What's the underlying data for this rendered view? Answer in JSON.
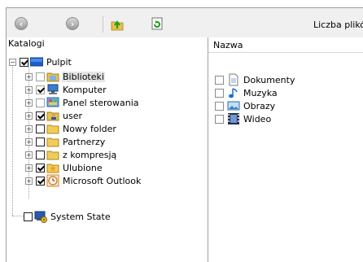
{
  "toolbar": {
    "back_icon": "back-arrow-icon",
    "forward_icon": "forward-arrow-icon",
    "up_icon": "up-folder-icon",
    "refresh_icon": "refresh-icon",
    "count_label": "Liczba plików"
  },
  "tree": {
    "header": "Katalogi",
    "items": [
      {
        "label": "Pulpit",
        "checked": true
      },
      {
        "label": "Biblioteki",
        "checked": false
      },
      {
        "label": "Komputer",
        "checked": true
      },
      {
        "label": "Panel sterowania",
        "checked": false
      },
      {
        "label": "user",
        "checked": true
      },
      {
        "label": "Nowy folder",
        "checked": false
      },
      {
        "label": "Partnerzy",
        "checked": false
      },
      {
        "label": "z kompresją",
        "checked": false
      },
      {
        "label": "Ulubione",
        "checked": true
      },
      {
        "label": "Microsoft Outlook",
        "checked": true
      },
      {
        "label": "System State",
        "checked": false
      }
    ]
  },
  "files": {
    "column_name": "Nazwa",
    "items": [
      {
        "label": "Dokumenty"
      },
      {
        "label": "Muzyka"
      },
      {
        "label": "Obrazy"
      },
      {
        "label": "Wideo"
      }
    ]
  }
}
